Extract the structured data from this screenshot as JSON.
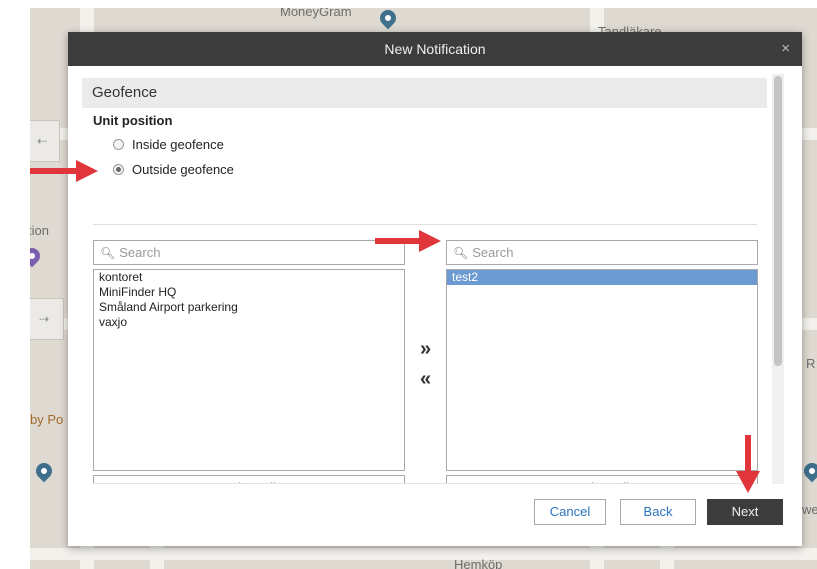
{
  "map": {
    "labels": [
      "MoneyGram",
      "Tandläkare",
      "tion",
      "by Po",
      "Hemköp",
      "R",
      "we"
    ]
  },
  "dialog": {
    "title": "New Notification",
    "close_glyph": "×",
    "section_title": "Geofence",
    "unit_position_label": "Unit position",
    "radio_options": [
      {
        "label": "Inside geofence",
        "checked": false
      },
      {
        "label": "Outside geofence",
        "checked": true
      }
    ],
    "left_list": {
      "search_placeholder": "Search",
      "items": [
        "kontoret",
        "MiniFinder HQ",
        "Småland Airport parkering",
        "vaxjo"
      ],
      "select_all_label": "Select All"
    },
    "right_list": {
      "search_placeholder": "Search",
      "items": [
        "test2"
      ],
      "selected_index": 0,
      "select_all_label": "Select All"
    },
    "move_right_glyph": "»",
    "move_left_glyph": "«",
    "footer": {
      "cancel_label": "Cancel",
      "back_label": "Back",
      "next_label": "Next"
    }
  },
  "colors": {
    "titlebar": "#3c3c3c",
    "accent_blue": "#2a73c0",
    "selection": "#6b9bd2",
    "annotation_arrow": "#e0353a"
  }
}
